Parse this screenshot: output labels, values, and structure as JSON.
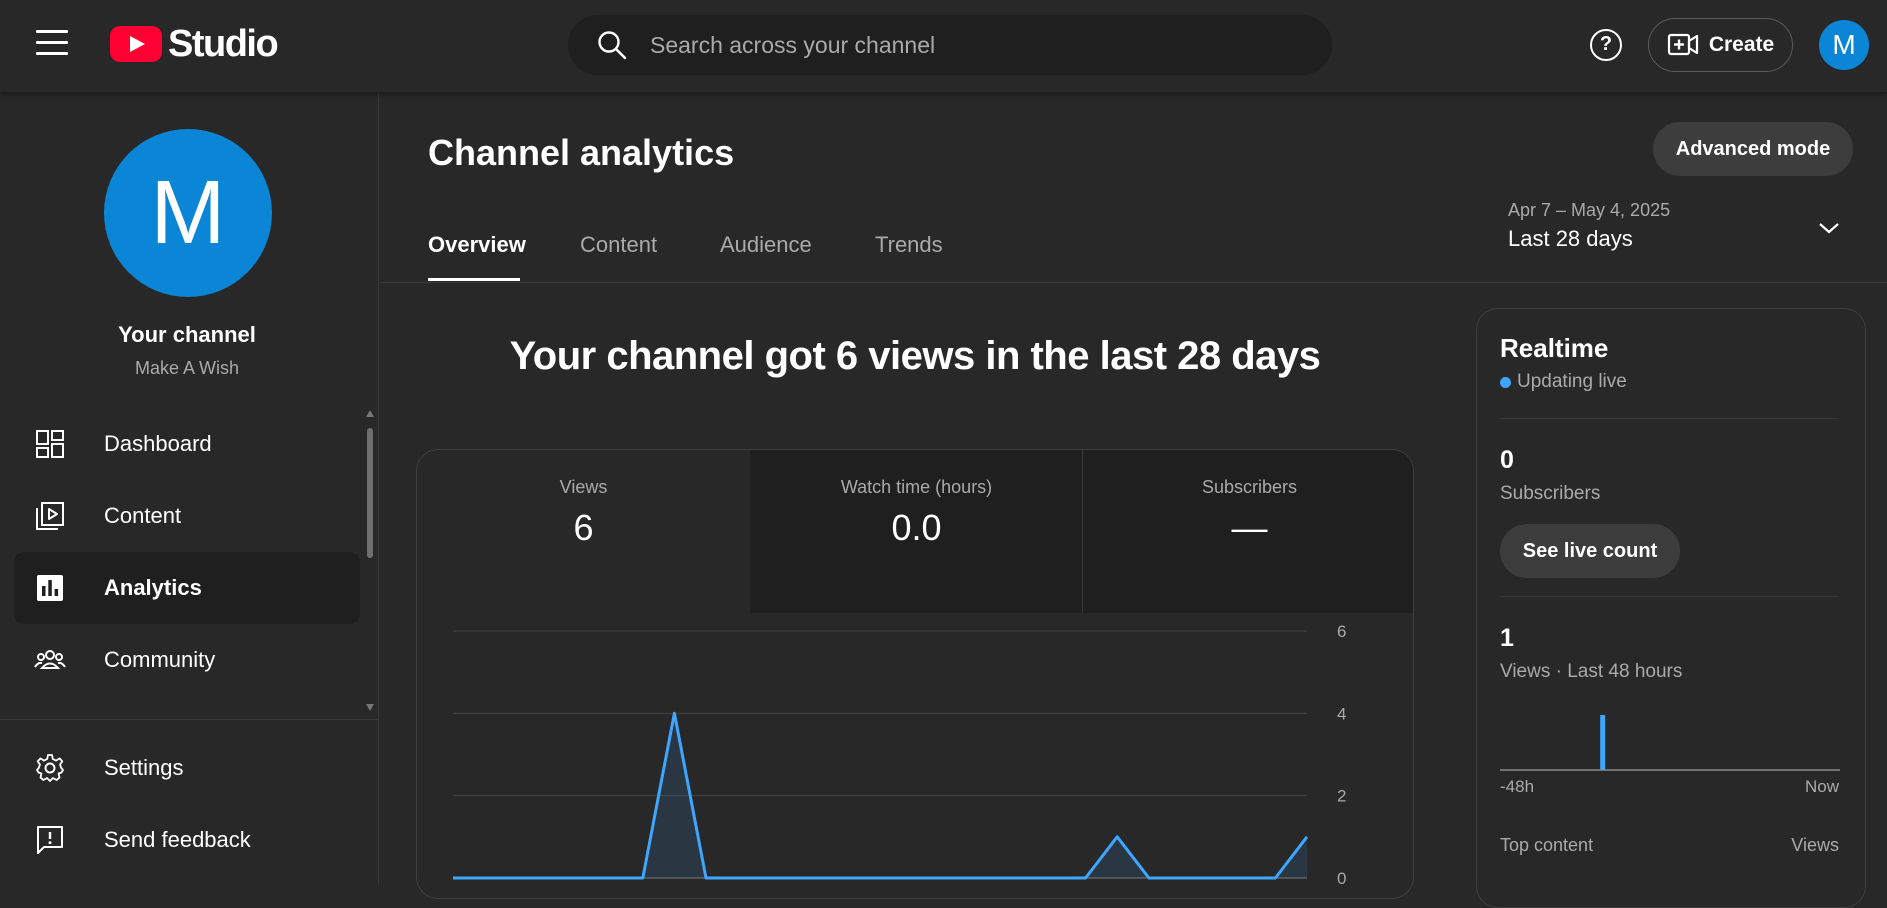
{
  "header": {
    "logo_text": "Studio",
    "search_placeholder": "Search across your channel",
    "help_label": "?",
    "create_label": "Create",
    "avatar_letter": "M"
  },
  "sidebar": {
    "avatar_letter": "M",
    "channel_name": "Your channel",
    "channel_subtitle": "Make A Wish",
    "items": [
      {
        "label": "Dashboard",
        "icon": "dashboard-icon"
      },
      {
        "label": "Content",
        "icon": "content-icon"
      },
      {
        "label": "Analytics",
        "icon": "analytics-icon",
        "active": true
      },
      {
        "label": "Community",
        "icon": "community-icon"
      }
    ],
    "bottom_items": [
      {
        "label": "Settings",
        "icon": "gear-icon"
      },
      {
        "label": "Send feedback",
        "icon": "feedback-icon"
      }
    ]
  },
  "main": {
    "title": "Channel analytics",
    "advanced_mode_label": "Advanced mode",
    "tabs": [
      {
        "label": "Overview",
        "active": true
      },
      {
        "label": "Content"
      },
      {
        "label": "Audience"
      },
      {
        "label": "Trends"
      }
    ],
    "date_range": "Apr 7 – May 4, 2025",
    "date_label": "Last 28 days",
    "headline": "Your channel got 6 views in the last 28 days",
    "metrics": [
      {
        "label": "Views",
        "value": "6",
        "selected": true
      },
      {
        "label": "Watch time (hours)",
        "value": "0.0"
      },
      {
        "label": "Subscribers",
        "value": "—"
      }
    ]
  },
  "realtime": {
    "title": "Realtime",
    "status": "Updating live",
    "subscribers_value": "0",
    "subscribers_label": "Subscribers",
    "live_count_label": "See live count",
    "views_value": "1",
    "views_label": "Views · Last 48 hours",
    "axis_start": "-48h",
    "axis_end": "Now",
    "top_content_label": "Top content",
    "top_content_col": "Views"
  },
  "chart_data": {
    "type": "line",
    "series": [
      {
        "values": [
          0,
          0,
          0,
          0,
          0,
          0,
          0,
          4,
          0,
          0,
          0,
          0,
          0,
          0,
          0,
          0,
          0,
          0,
          0,
          0,
          0,
          1,
          0,
          0,
          0,
          0,
          0,
          1
        ]
      }
    ],
    "ylim": [
      0,
      6
    ],
    "yticks": [
      "6",
      "4",
      "2",
      "0"
    ],
    "grid": true,
    "color": "#3ea6ff"
  },
  "realtime_chart": {
    "type": "bar",
    "values_hourly_last48": [
      0,
      0,
      0,
      0,
      0,
      0,
      0,
      0,
      0,
      0,
      0,
      0,
      0,
      0,
      1,
      0,
      0,
      0,
      0,
      0,
      0,
      0,
      0,
      0,
      0,
      0,
      0,
      0,
      0,
      0,
      0,
      0,
      0,
      0,
      0,
      0,
      0,
      0,
      0,
      0,
      0,
      0,
      0,
      0,
      0,
      0,
      0,
      0
    ],
    "color": "#3ea6ff"
  }
}
